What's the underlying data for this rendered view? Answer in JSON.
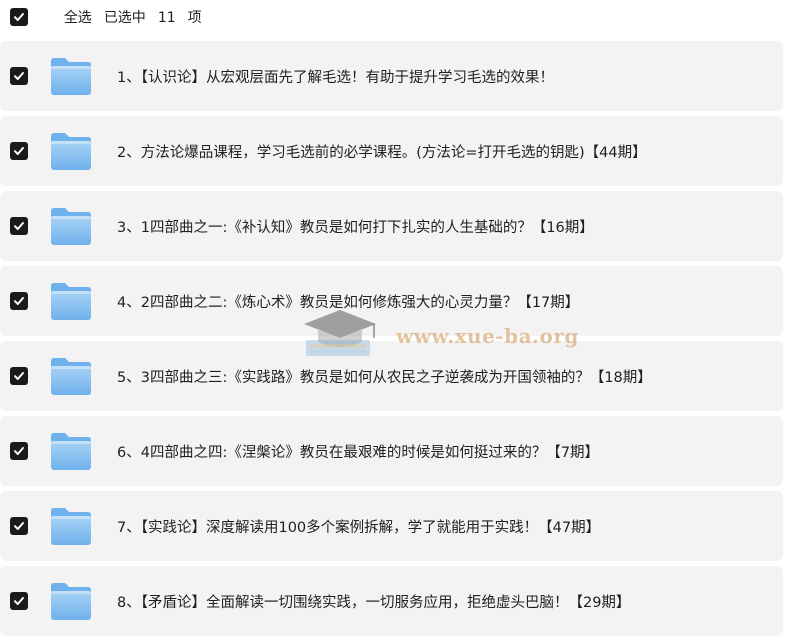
{
  "header": {
    "select_all_label": "全选",
    "selected_prefix": "已选中",
    "selected_count": "11",
    "selected_suffix": "项"
  },
  "items": [
    {
      "label": "1、【认识论】从宏观层面先了解毛选！有助于提升学习毛选的效果！",
      "checked": true,
      "icon": "folder-icon"
    },
    {
      "label": "2、方法论爆品课程，学习毛选前的必学课程。(方法论=打开毛选的钥匙)【44期】",
      "checked": true,
      "icon": "folder-icon"
    },
    {
      "label": "3、1四部曲之一:《补认知》教员是如何打下扎实的人生基础的？【16期】",
      "checked": true,
      "icon": "folder-icon"
    },
    {
      "label": "4、2四部曲之二:《炼心术》教员是如何修炼强大的心灵力量？【17期】",
      "checked": true,
      "icon": "folder-icon"
    },
    {
      "label": "5、3四部曲之三:《实践路》教员是如何从农民之子逆袭成为开国领袖的？【18期】",
      "checked": true,
      "icon": "folder-icon"
    },
    {
      "label": "6、4四部曲之四:《涅槃论》教员在最艰难的时候是如何挺过来的？【7期】",
      "checked": true,
      "icon": "folder-icon"
    },
    {
      "label": "7、【实践论】深度解读用100多个案例拆解，学了就能用于实践！【47期】",
      "checked": true,
      "icon": "folder-icon"
    },
    {
      "label": "8、【矛盾论】全面解读一切围绕实践，一切服务应用，拒绝虚头巴脑！【29期】",
      "checked": true,
      "icon": "folder-icon"
    }
  ],
  "watermark": {
    "text": "www.xue-ba.org",
    "icon": "graduation-cap-icon"
  },
  "colors": {
    "row_background": "#f3f3f3",
    "checkbox": "#1a1a1a",
    "folder_light": "#a8d3f5",
    "folder_dark": "#6fb1ec",
    "watermark": "#cd9650"
  }
}
